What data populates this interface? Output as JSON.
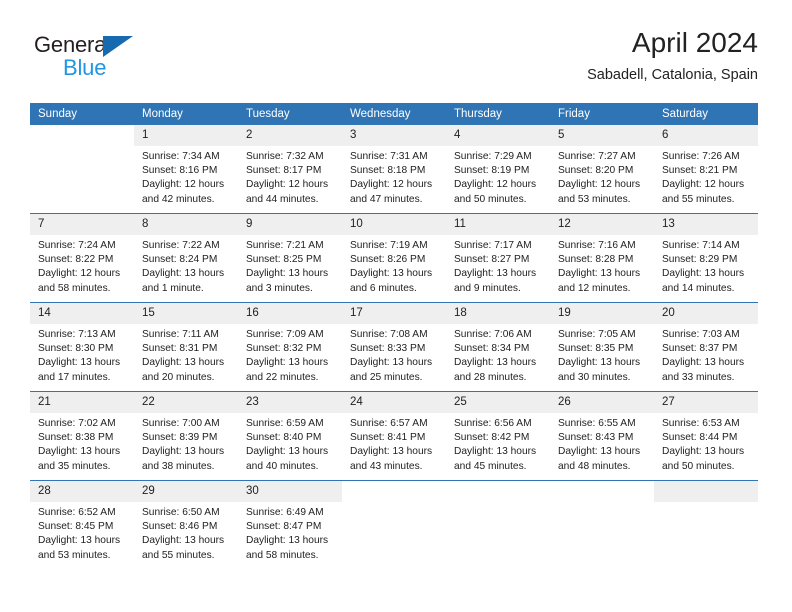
{
  "brand": {
    "name_part1": "General",
    "name_part2": "Blue",
    "accent_color": "#1769b0",
    "blue_text_color": "#2196e3"
  },
  "header": {
    "title": "April 2024",
    "subtitle": "Sabadell, Catalonia, Spain"
  },
  "theme": {
    "header_row_color": "#2f74b5",
    "day_band_color": "#efefef",
    "separator_color": "#2f74b5",
    "text_color": "#222222"
  },
  "weekday_headers": [
    "Sunday",
    "Monday",
    "Tuesday",
    "Wednesday",
    "Thursday",
    "Friday",
    "Saturday"
  ],
  "labels": {
    "sunrise_prefix": "Sunrise:",
    "sunset_prefix": "Sunset:",
    "daylight_prefix": "Daylight:"
  },
  "weeks": [
    {
      "days": [
        {
          "date": "",
          "empty": true,
          "shaded": false,
          "sunrise": "",
          "sunset": "",
          "daylight_line1": "",
          "daylight_line2": ""
        },
        {
          "date": "1",
          "empty": false,
          "shaded": true,
          "sunrise": "Sunrise: 7:34 AM",
          "sunset": "Sunset: 8:16 PM",
          "daylight_line1": "Daylight: 12 hours",
          "daylight_line2": "and 42 minutes."
        },
        {
          "date": "2",
          "empty": false,
          "shaded": true,
          "sunrise": "Sunrise: 7:32 AM",
          "sunset": "Sunset: 8:17 PM",
          "daylight_line1": "Daylight: 12 hours",
          "daylight_line2": "and 44 minutes."
        },
        {
          "date": "3",
          "empty": false,
          "shaded": true,
          "sunrise": "Sunrise: 7:31 AM",
          "sunset": "Sunset: 8:18 PM",
          "daylight_line1": "Daylight: 12 hours",
          "daylight_line2": "and 47 minutes."
        },
        {
          "date": "4",
          "empty": false,
          "shaded": true,
          "sunrise": "Sunrise: 7:29 AM",
          "sunset": "Sunset: 8:19 PM",
          "daylight_line1": "Daylight: 12 hours",
          "daylight_line2": "and 50 minutes."
        },
        {
          "date": "5",
          "empty": false,
          "shaded": true,
          "sunrise": "Sunrise: 7:27 AM",
          "sunset": "Sunset: 8:20 PM",
          "daylight_line1": "Daylight: 12 hours",
          "daylight_line2": "and 53 minutes."
        },
        {
          "date": "6",
          "empty": false,
          "shaded": true,
          "sunrise": "Sunrise: 7:26 AM",
          "sunset": "Sunset: 8:21 PM",
          "daylight_line1": "Daylight: 12 hours",
          "daylight_line2": "and 55 minutes."
        }
      ]
    },
    {
      "days": [
        {
          "date": "7",
          "empty": false,
          "shaded": true,
          "sunrise": "Sunrise: 7:24 AM",
          "sunset": "Sunset: 8:22 PM",
          "daylight_line1": "Daylight: 12 hours",
          "daylight_line2": "and 58 minutes."
        },
        {
          "date": "8",
          "empty": false,
          "shaded": true,
          "sunrise": "Sunrise: 7:22 AM",
          "sunset": "Sunset: 8:24 PM",
          "daylight_line1": "Daylight: 13 hours",
          "daylight_line2": "and 1 minute."
        },
        {
          "date": "9",
          "empty": false,
          "shaded": true,
          "sunrise": "Sunrise: 7:21 AM",
          "sunset": "Sunset: 8:25 PM",
          "daylight_line1": "Daylight: 13 hours",
          "daylight_line2": "and 3 minutes."
        },
        {
          "date": "10",
          "empty": false,
          "shaded": true,
          "sunrise": "Sunrise: 7:19 AM",
          "sunset": "Sunset: 8:26 PM",
          "daylight_line1": "Daylight: 13 hours",
          "daylight_line2": "and 6 minutes."
        },
        {
          "date": "11",
          "empty": false,
          "shaded": true,
          "sunrise": "Sunrise: 7:17 AM",
          "sunset": "Sunset: 8:27 PM",
          "daylight_line1": "Daylight: 13 hours",
          "daylight_line2": "and 9 minutes."
        },
        {
          "date": "12",
          "empty": false,
          "shaded": true,
          "sunrise": "Sunrise: 7:16 AM",
          "sunset": "Sunset: 8:28 PM",
          "daylight_line1": "Daylight: 13 hours",
          "daylight_line2": "and 12 minutes."
        },
        {
          "date": "13",
          "empty": false,
          "shaded": true,
          "sunrise": "Sunrise: 7:14 AM",
          "sunset": "Sunset: 8:29 PM",
          "daylight_line1": "Daylight: 13 hours",
          "daylight_line2": "and 14 minutes."
        }
      ]
    },
    {
      "days": [
        {
          "date": "14",
          "empty": false,
          "shaded": true,
          "sunrise": "Sunrise: 7:13 AM",
          "sunset": "Sunset: 8:30 PM",
          "daylight_line1": "Daylight: 13 hours",
          "daylight_line2": "and 17 minutes."
        },
        {
          "date": "15",
          "empty": false,
          "shaded": true,
          "sunrise": "Sunrise: 7:11 AM",
          "sunset": "Sunset: 8:31 PM",
          "daylight_line1": "Daylight: 13 hours",
          "daylight_line2": "and 20 minutes."
        },
        {
          "date": "16",
          "empty": false,
          "shaded": true,
          "sunrise": "Sunrise: 7:09 AM",
          "sunset": "Sunset: 8:32 PM",
          "daylight_line1": "Daylight: 13 hours",
          "daylight_line2": "and 22 minutes."
        },
        {
          "date": "17",
          "empty": false,
          "shaded": true,
          "sunrise": "Sunrise: 7:08 AM",
          "sunset": "Sunset: 8:33 PM",
          "daylight_line1": "Daylight: 13 hours",
          "daylight_line2": "and 25 minutes."
        },
        {
          "date": "18",
          "empty": false,
          "shaded": true,
          "sunrise": "Sunrise: 7:06 AM",
          "sunset": "Sunset: 8:34 PM",
          "daylight_line1": "Daylight: 13 hours",
          "daylight_line2": "and 28 minutes."
        },
        {
          "date": "19",
          "empty": false,
          "shaded": true,
          "sunrise": "Sunrise: 7:05 AM",
          "sunset": "Sunset: 8:35 PM",
          "daylight_line1": "Daylight: 13 hours",
          "daylight_line2": "and 30 minutes."
        },
        {
          "date": "20",
          "empty": false,
          "shaded": true,
          "sunrise": "Sunrise: 7:03 AM",
          "sunset": "Sunset: 8:37 PM",
          "daylight_line1": "Daylight: 13 hours",
          "daylight_line2": "and 33 minutes."
        }
      ]
    },
    {
      "days": [
        {
          "date": "21",
          "empty": false,
          "shaded": true,
          "sunrise": "Sunrise: 7:02 AM",
          "sunset": "Sunset: 8:38 PM",
          "daylight_line1": "Daylight: 13 hours",
          "daylight_line2": "and 35 minutes."
        },
        {
          "date": "22",
          "empty": false,
          "shaded": true,
          "sunrise": "Sunrise: 7:00 AM",
          "sunset": "Sunset: 8:39 PM",
          "daylight_line1": "Daylight: 13 hours",
          "daylight_line2": "and 38 minutes."
        },
        {
          "date": "23",
          "empty": false,
          "shaded": true,
          "sunrise": "Sunrise: 6:59 AM",
          "sunset": "Sunset: 8:40 PM",
          "daylight_line1": "Daylight: 13 hours",
          "daylight_line2": "and 40 minutes."
        },
        {
          "date": "24",
          "empty": false,
          "shaded": true,
          "sunrise": "Sunrise: 6:57 AM",
          "sunset": "Sunset: 8:41 PM",
          "daylight_line1": "Daylight: 13 hours",
          "daylight_line2": "and 43 minutes."
        },
        {
          "date": "25",
          "empty": false,
          "shaded": true,
          "sunrise": "Sunrise: 6:56 AM",
          "sunset": "Sunset: 8:42 PM",
          "daylight_line1": "Daylight: 13 hours",
          "daylight_line2": "and 45 minutes."
        },
        {
          "date": "26",
          "empty": false,
          "shaded": true,
          "sunrise": "Sunrise: 6:55 AM",
          "sunset": "Sunset: 8:43 PM",
          "daylight_line1": "Daylight: 13 hours",
          "daylight_line2": "and 48 minutes."
        },
        {
          "date": "27",
          "empty": false,
          "shaded": true,
          "sunrise": "Sunrise: 6:53 AM",
          "sunset": "Sunset: 8:44 PM",
          "daylight_line1": "Daylight: 13 hours",
          "daylight_line2": "and 50 minutes."
        }
      ]
    },
    {
      "days": [
        {
          "date": "28",
          "empty": false,
          "shaded": true,
          "sunrise": "Sunrise: 6:52 AM",
          "sunset": "Sunset: 8:45 PM",
          "daylight_line1": "Daylight: 13 hours",
          "daylight_line2": "and 53 minutes."
        },
        {
          "date": "29",
          "empty": false,
          "shaded": true,
          "sunrise": "Sunrise: 6:50 AM",
          "sunset": "Sunset: 8:46 PM",
          "daylight_line1": "Daylight: 13 hours",
          "daylight_line2": "and 55 minutes."
        },
        {
          "date": "30",
          "empty": false,
          "shaded": true,
          "sunrise": "Sunrise: 6:49 AM",
          "sunset": "Sunset: 8:47 PM",
          "daylight_line1": "Daylight: 13 hours",
          "daylight_line2": "and 58 minutes."
        },
        {
          "date": "",
          "empty": true,
          "shaded": false,
          "sunrise": "",
          "sunset": "",
          "daylight_line1": "",
          "daylight_line2": ""
        },
        {
          "date": "",
          "empty": true,
          "shaded": false,
          "sunrise": "",
          "sunset": "",
          "daylight_line1": "",
          "daylight_line2": ""
        },
        {
          "date": "",
          "empty": true,
          "shaded": false,
          "sunrise": "",
          "sunset": "",
          "daylight_line1": "",
          "daylight_line2": ""
        },
        {
          "date": "",
          "empty": true,
          "shaded": true,
          "sunrise": "",
          "sunset": "",
          "daylight_line1": "",
          "daylight_line2": ""
        }
      ]
    }
  ]
}
